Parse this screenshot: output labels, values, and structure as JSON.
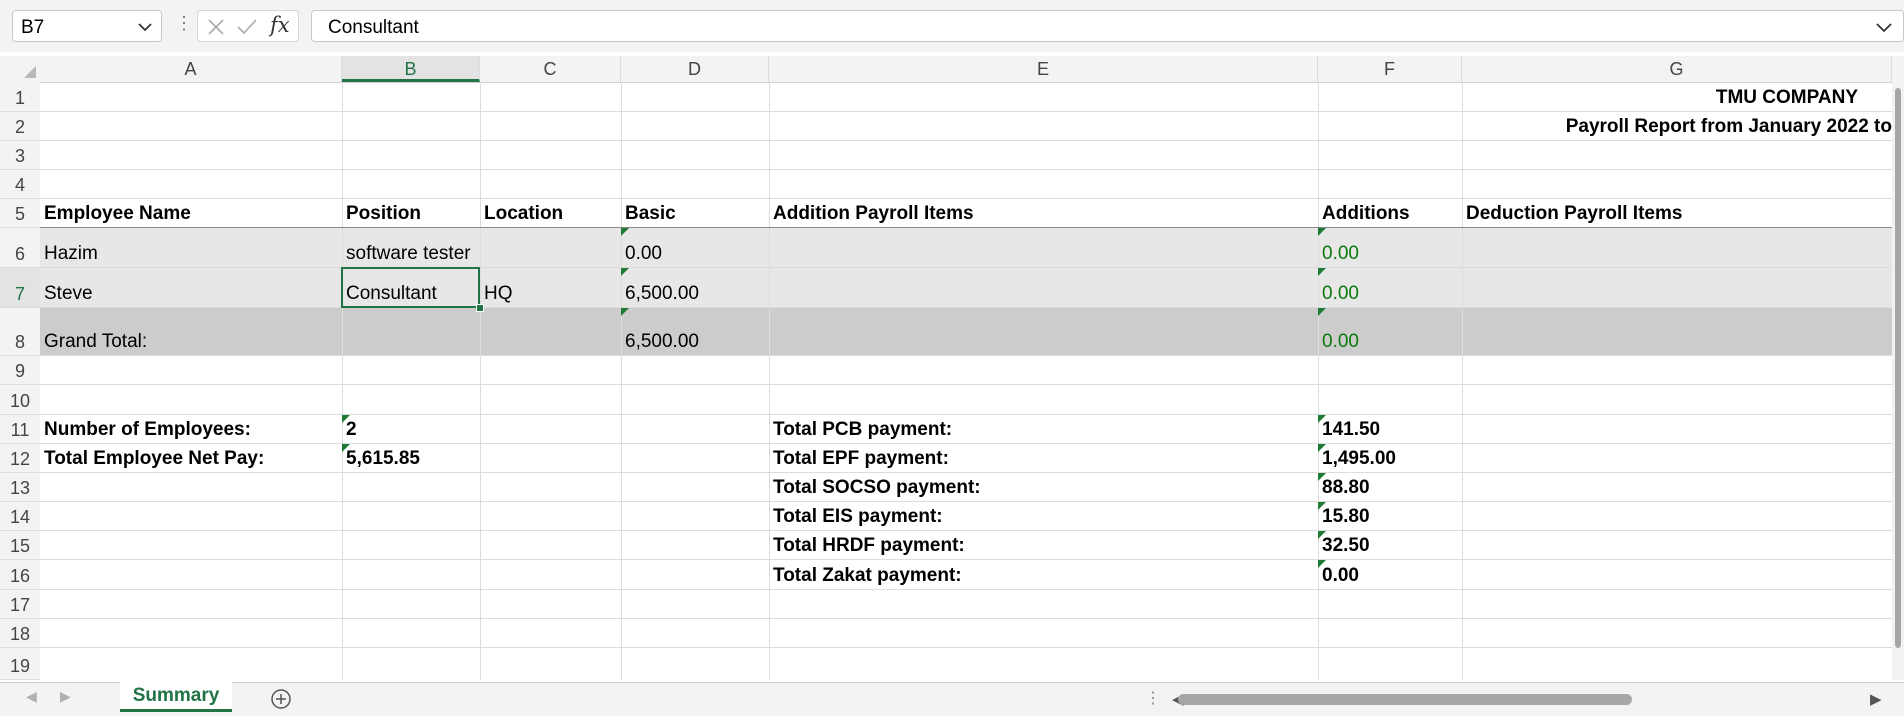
{
  "formula_bar": {
    "name_box": "B7",
    "fx_label": "fx",
    "content": "Consultant"
  },
  "columns": [
    "A",
    "B",
    "C",
    "D",
    "E",
    "F",
    "G"
  ],
  "selected_column": "B",
  "rows": [
    "1",
    "2",
    "3",
    "4",
    "5",
    "6",
    "7",
    "8",
    "9",
    "10",
    "11",
    "12",
    "13",
    "14",
    "15",
    "16",
    "17",
    "18",
    "19"
  ],
  "selected_row": "7",
  "cells": {
    "company": "TMU COMPANY",
    "report_title": "Payroll Report from January 2022 to",
    "headers": {
      "employee_name": "Employee Name",
      "position": "Position",
      "location": "Location",
      "basic": "Basic",
      "addition_items": "Addition Payroll Items",
      "additions": "Additions",
      "deduction_items": "Deduction Payroll Items"
    },
    "employees": [
      {
        "name": "Hazim",
        "position": "software tester",
        "location": "",
        "basic": "0.00",
        "additions": "0.00"
      },
      {
        "name": "Steve",
        "position": "Consultant",
        "location": "HQ",
        "basic": "6,500.00",
        "additions": "0.00"
      }
    ],
    "grand_total": {
      "label": "Grand Total:",
      "basic": "6,500.00",
      "additions": "0.00"
    },
    "summary_left": [
      {
        "label": "Number of Employees:",
        "value": "2"
      },
      {
        "label": "Total Employee Net Pay:",
        "value": "5,615.85"
      }
    ],
    "summary_right": [
      {
        "label": "Total PCB payment:",
        "value": "141.50"
      },
      {
        "label": "Total EPF payment:",
        "value": "1,495.00"
      },
      {
        "label": "Total SOCSO payment:",
        "value": "88.80"
      },
      {
        "label": "Total EIS payment:",
        "value": "15.80"
      },
      {
        "label": "Total HRDF payment:",
        "value": "32.50"
      },
      {
        "label": "Total Zakat payment:",
        "value": "0.00"
      }
    ]
  },
  "sheet_tabs": [
    {
      "label": "Summary",
      "active": true
    }
  ],
  "colors": {
    "accent": "#217346",
    "green_value": "#0a7a0a",
    "row_band": "#e7e7e7",
    "total_band": "#cccccc"
  }
}
